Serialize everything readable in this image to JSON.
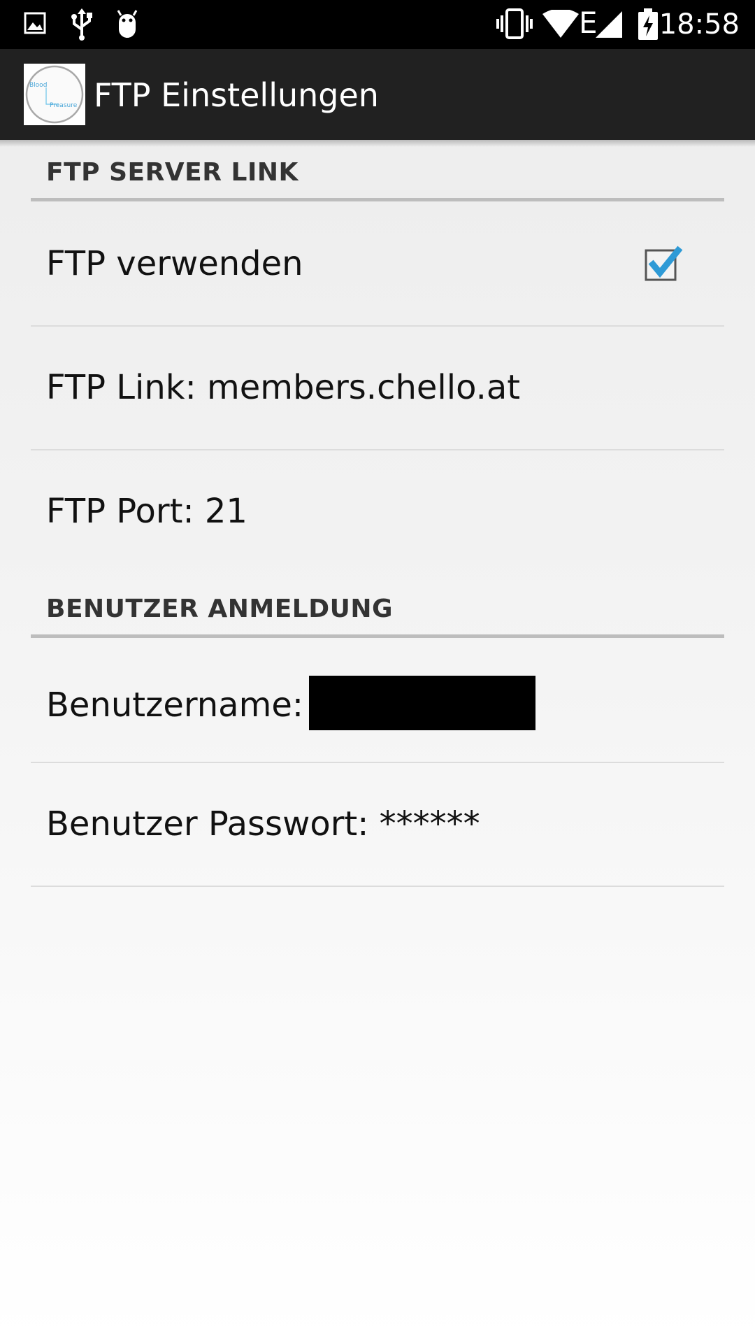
{
  "status_bar": {
    "time": "18:58",
    "icons": [
      "gallery-icon",
      "usb-icon",
      "android-debug-icon",
      "vibrate-icon",
      "wifi-icon",
      "signal-edge-icon",
      "battery-charging-icon"
    ],
    "network_type": "E"
  },
  "app_bar": {
    "title": "FTP Einstellungen",
    "logo_text_1": "Blood",
    "logo_text_2": "Preasure"
  },
  "sections": [
    {
      "header": "FTP SERVER LINK",
      "items": [
        {
          "label": "FTP verwenden",
          "type": "checkbox",
          "checked": true
        },
        {
          "label": "FTP Link: members.chello.at",
          "type": "text"
        },
        {
          "label": "FTP Port: 21",
          "type": "text"
        }
      ]
    },
    {
      "header": "BENUTZER ANMELDUNG",
      "items": [
        {
          "label": "Benutzername:",
          "type": "text",
          "value_redacted": true
        },
        {
          "label": "Benutzer Passwort: ******",
          "type": "text"
        }
      ]
    }
  ],
  "colors": {
    "status_bar": "#000000",
    "app_bar": "#212121",
    "checkbox_check": "#2e9ad6",
    "section_divider": "#bdbdbd",
    "row_divider": "#dcdcdc"
  }
}
